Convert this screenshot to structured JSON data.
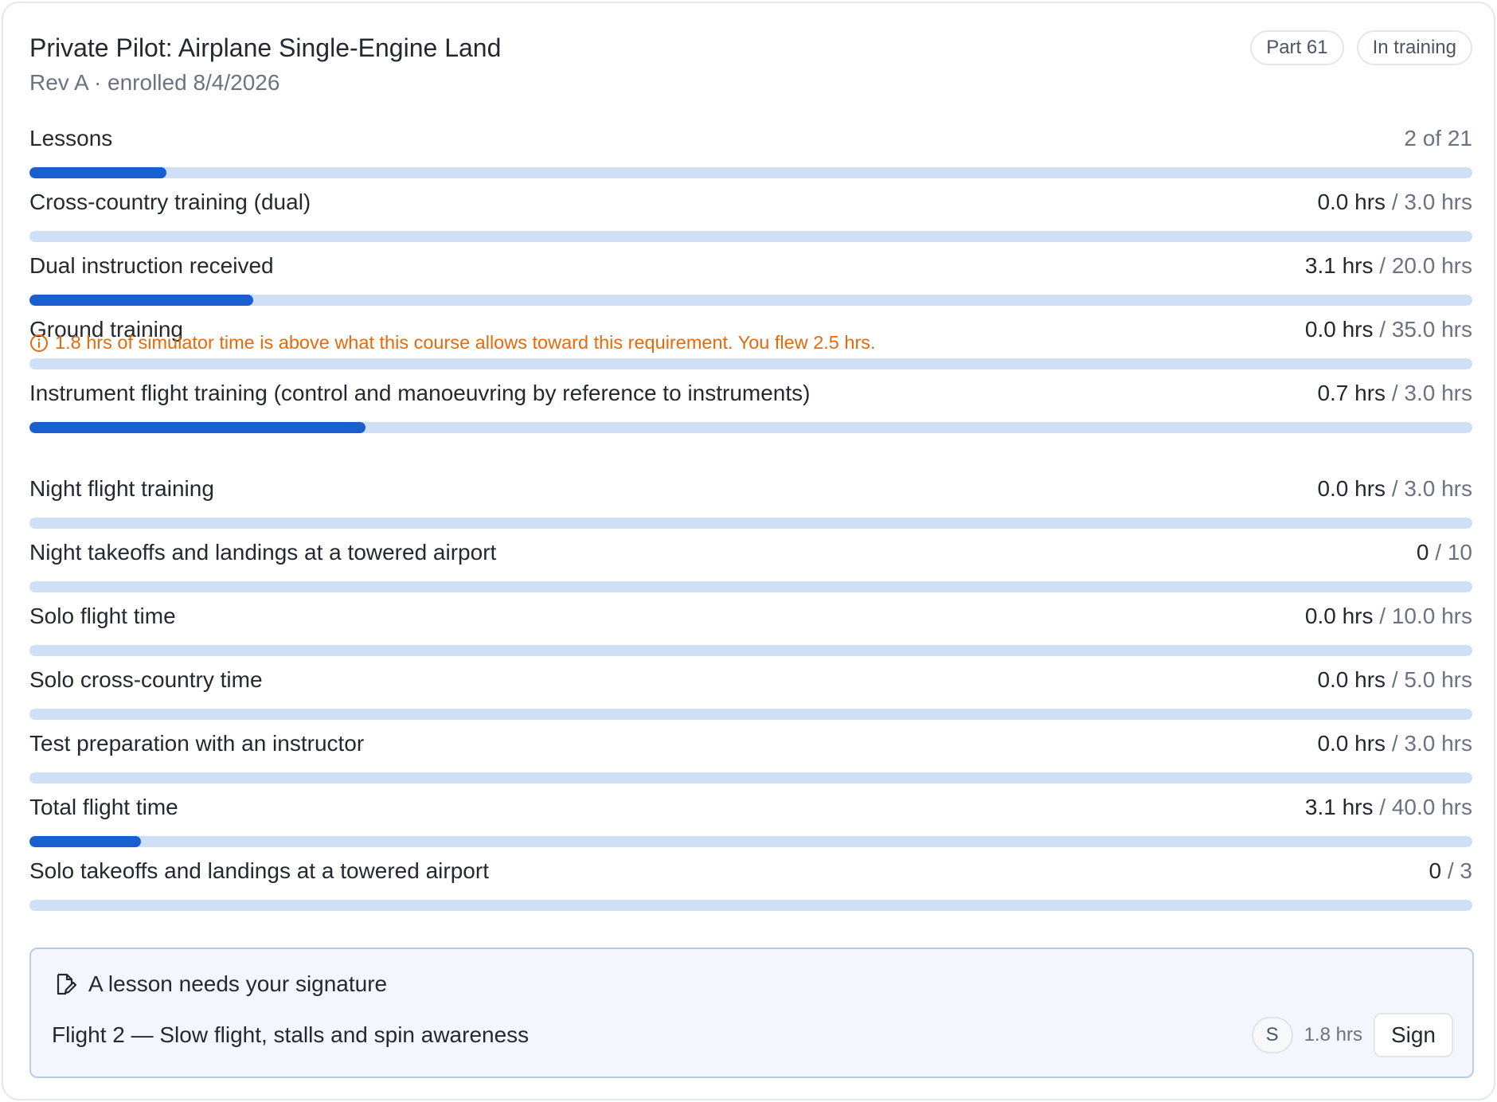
{
  "header": {
    "title": "Private Pilot: Airplane Single-Engine Land",
    "subtitle": "Rev A · enrolled 8/4/2026",
    "badges": [
      "Part 61",
      "In training"
    ]
  },
  "lessons": {
    "label": "Lessons",
    "value": "2 of 21",
    "progress": 0.095
  },
  "requirements": [
    {
      "label": "Cross-country training (dual)",
      "current": "0.0 hrs",
      "total": "3.0 hrs",
      "progress": 0
    },
    {
      "label": "Dual instruction received",
      "current": "3.1 hrs",
      "total": "20.0 hrs",
      "progress": 0.155
    },
    {
      "label": "Ground training",
      "current": "0.0 hrs",
      "total": "35.0 hrs",
      "progress": 0
    },
    {
      "label": "Instrument flight training (control and manoeuvring by reference to instruments)",
      "current": "0.7 hrs",
      "total": "3.0 hrs",
      "progress": 0.233
    },
    {
      "label": "Night flight training",
      "current": "0.0 hrs",
      "total": "3.0 hrs",
      "progress": 0
    },
    {
      "label": "Night takeoffs and landings at a towered airport",
      "current": "0",
      "total": "10",
      "progress": 0
    },
    {
      "label": "Solo flight time",
      "current": "0.0 hrs",
      "total": "10.0 hrs",
      "progress": 0
    },
    {
      "label": "Solo cross-country time",
      "current": "0.0 hrs",
      "total": "5.0 hrs",
      "progress": 0
    },
    {
      "label": "Test preparation with an instructor",
      "current": "0.0 hrs",
      "total": "3.0 hrs",
      "progress": 0
    },
    {
      "label": "Total flight time",
      "current": "3.1 hrs",
      "total": "40.0 hrs",
      "progress": 0.0775
    },
    {
      "label": "Solo takeoffs and landings at a towered airport",
      "current": "0",
      "total": "3",
      "progress": 0
    }
  ],
  "separator": "/",
  "warning": {
    "icon": "info-circle-icon",
    "text": "1.8 hrs of simulator time is above what this course allows toward this requirement. You flew 2.5 hrs."
  },
  "signature": {
    "icon": "document-edit-icon",
    "title": "A lesson needs your signature",
    "lesson": "Flight 2 — Slow flight, stalls and spin awareness",
    "avatar": "S",
    "hours": "1.8 hrs",
    "button": "Sign"
  },
  "colors": {
    "accent": "#1a5fd0",
    "track": "#cfe0f6",
    "warning": "#e46a0d"
  }
}
